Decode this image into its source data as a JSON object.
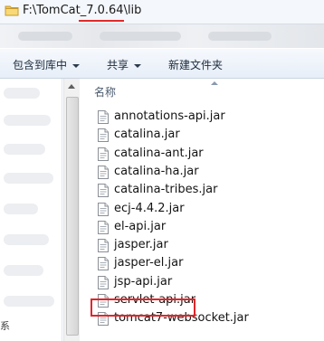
{
  "address": {
    "path": "F:\\TomCat_7.0.64\\lib",
    "icon": "folder-icon"
  },
  "toolbar": {
    "include_label": "包含到库中",
    "share_label": "共享",
    "new_folder_label": "新建文件夹"
  },
  "list": {
    "column_name": "名称",
    "files": [
      {
        "name": "annotations-api.jar",
        "icon": "jar-file-icon"
      },
      {
        "name": "catalina.jar",
        "icon": "jar-file-icon"
      },
      {
        "name": "catalina-ant.jar",
        "icon": "jar-file-icon"
      },
      {
        "name": "catalina-ha.jar",
        "icon": "jar-file-icon"
      },
      {
        "name": "catalina-tribes.jar",
        "icon": "jar-file-icon"
      },
      {
        "name": "ecj-4.4.2.jar",
        "icon": "jar-file-icon"
      },
      {
        "name": "el-api.jar",
        "icon": "jar-file-icon"
      },
      {
        "name": "jasper.jar",
        "icon": "jar-file-icon"
      },
      {
        "name": "jasper-el.jar",
        "icon": "jar-file-icon"
      },
      {
        "name": "jsp-api.jar",
        "icon": "jar-file-icon"
      },
      {
        "name": "servlet-api.jar",
        "icon": "jar-file-icon",
        "highlighted": true
      },
      {
        "name": "tomcat7-websocket.jar",
        "icon": "jar-file-icon"
      }
    ]
  },
  "nav": {
    "trailing_text": "系"
  },
  "colors": {
    "highlight": "#e0262b",
    "underline": "#e02b2b"
  }
}
